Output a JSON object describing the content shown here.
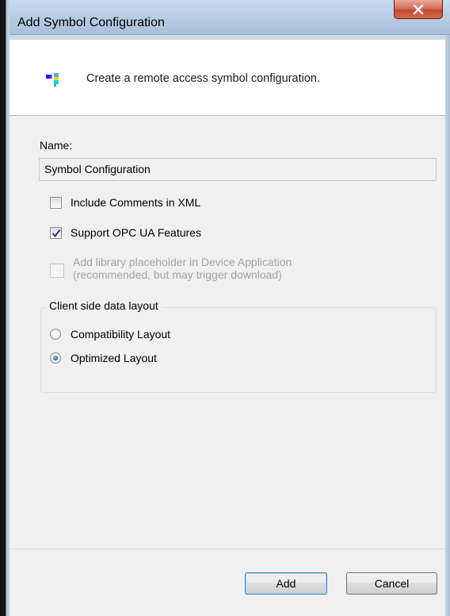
{
  "window": {
    "title": "Add Symbol Configuration",
    "close_label": "x"
  },
  "header": {
    "icon": "symbol-configuration-icon",
    "description": "Create a remote access symbol configuration."
  },
  "form": {
    "name_label": "Name:",
    "name_value": "Symbol Configuration",
    "include_comments": {
      "label": "Include Comments in XML",
      "checked": false
    },
    "support_opc_ua": {
      "label": "Support OPC UA Features",
      "checked": true
    },
    "library_placeholder": {
      "label_line1": "Add library placeholder in Device Application",
      "label_line2": "(recommended, but may trigger download)",
      "checked": false,
      "disabled": true
    },
    "layout_group": {
      "title": "Client side data layout",
      "options": [
        {
          "label": "Compatibility Layout",
          "selected": false
        },
        {
          "label": "Optimized Layout",
          "selected": true
        }
      ]
    }
  },
  "buttons": {
    "add": "Add",
    "cancel": "Cancel"
  },
  "colors": {
    "title_bar": "#b8cde3",
    "close_button": "#c24a31",
    "dialog_bg": "#f0f0f0",
    "header_bg": "#ffffff",
    "disabled_text": "#a3a3a3",
    "radio_selected": "#1a6bc4"
  }
}
